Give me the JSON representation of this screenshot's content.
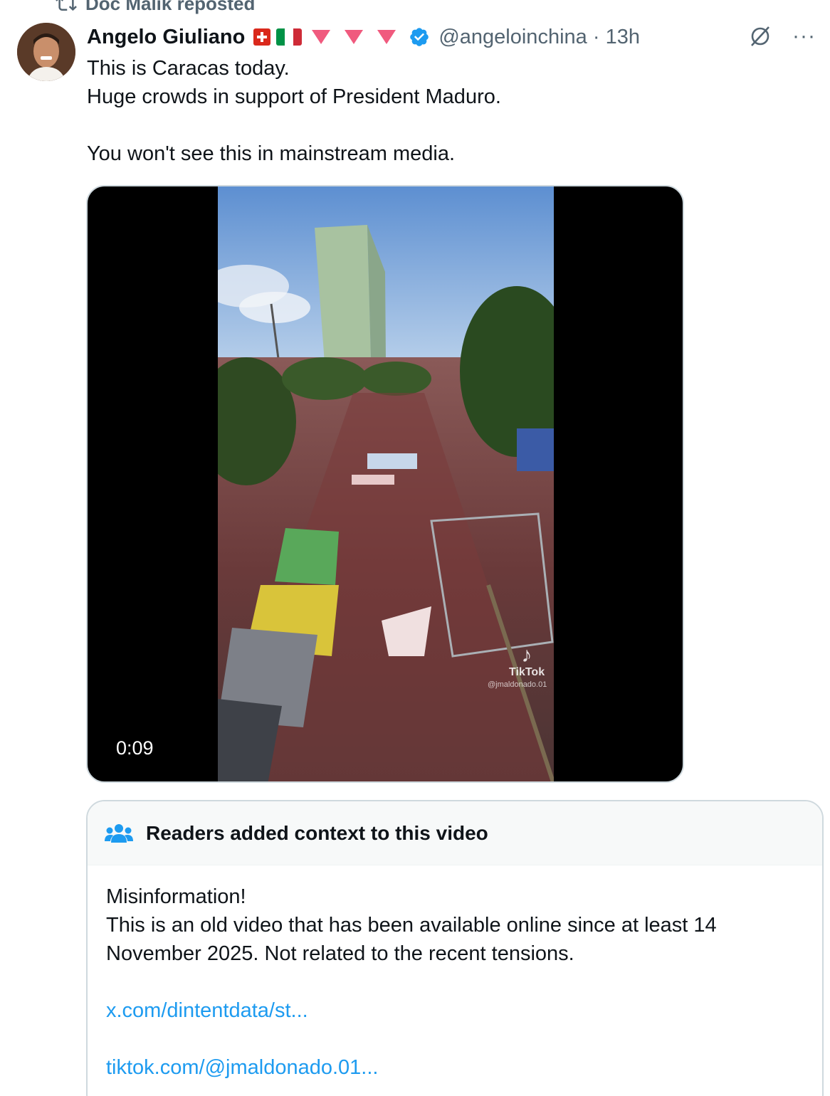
{
  "repost": {
    "text": "Doc Malik reposted"
  },
  "author": {
    "name": "Angelo Giuliano",
    "handle": "@angeloinchina",
    "separator": "·",
    "time": "13h",
    "badges": [
      "swiss-flag-icon",
      "italian-flag-icon",
      "red-triangle-icon",
      "red-triangle-icon",
      "red-triangle-icon",
      "verified-icon"
    ]
  },
  "tweet": {
    "lines": [
      "This is Caracas today.",
      "Huge crowds in support of President Maduro.",
      "",
      "You won't see this in mainstream media."
    ]
  },
  "video": {
    "duration": "0:09",
    "watermark": "TikTok",
    "watermark_handle": "@jmaldonado.01"
  },
  "community_note": {
    "title": "Readers added context to this video",
    "lines": [
      "Misinformation!",
      "This is an old video that has been available online since at least 14",
      "November 2025. Not related to the recent tensions."
    ],
    "links": [
      "x.com/dintentdata/st...",
      "tiktok.com/@jmaldonado.01..."
    ]
  },
  "colors": {
    "text": "#0f1419",
    "secondary": "#536471",
    "link": "#1d9bf0",
    "verified": "#1d9bf0",
    "triangle": "#f05a7e",
    "border": "#cfd9de"
  },
  "icons": {
    "repost": "repost-icon",
    "grok": "grok-icon",
    "more": "more-icon",
    "community": "people-icon"
  }
}
